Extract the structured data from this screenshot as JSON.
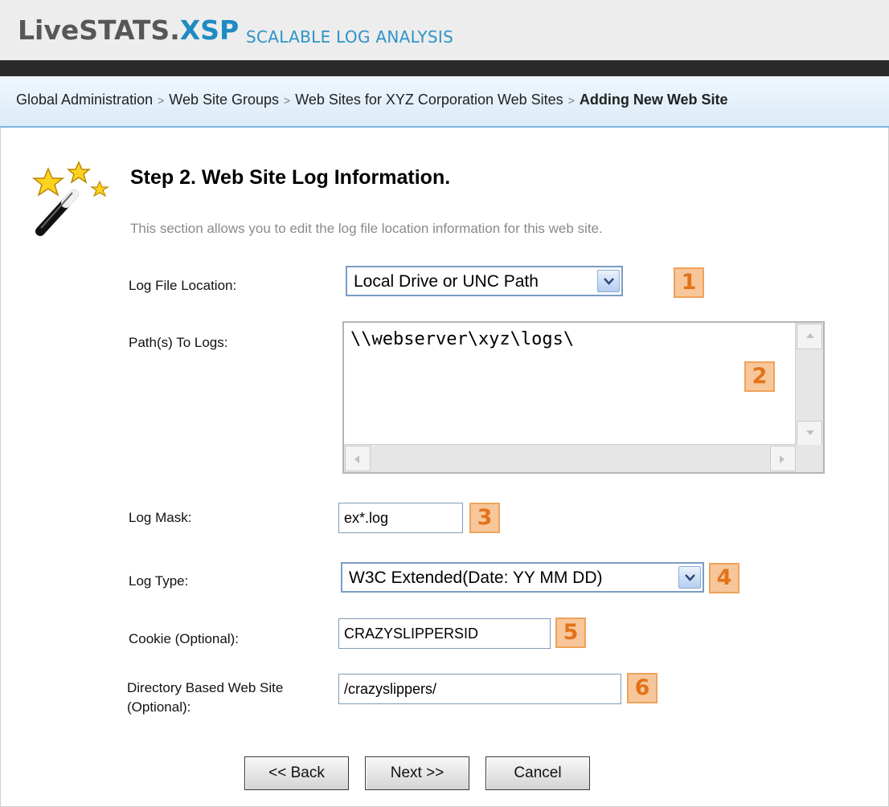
{
  "header": {
    "logo_live": "LiveSTATS.",
    "logo_xsp": "XSP",
    "tagline": "SCALABLE LOG ANALYSIS"
  },
  "breadcrumb": {
    "items": [
      "Global Administration",
      "Web Site Groups",
      "Web Sites for XYZ Corporation Web Sites"
    ],
    "separator": ">",
    "current": "Adding New Web Site"
  },
  "step": {
    "title": "Step 2. Web Site Log Information.",
    "description": "This section allows you to edit the log file location information for this web site."
  },
  "form": {
    "log_location": {
      "label": "Log File Location:",
      "value": "Local Drive or UNC Path",
      "badge": "1"
    },
    "paths": {
      "label": "Path(s) To Logs:",
      "value": "\\\\webserver\\xyz\\logs\\",
      "badge": "2"
    },
    "log_mask": {
      "label": "Log Mask:",
      "value": "ex*.log",
      "badge": "3"
    },
    "log_type": {
      "label": "Log Type:",
      "value": "W3C Extended(Date: YY MM DD)",
      "badge": "4"
    },
    "cookie": {
      "label": "Cookie (Optional):",
      "value": "CRAZYSLIPPERSID",
      "badge": "5"
    },
    "directory": {
      "label_line1": "Directory Based Web Site",
      "label_line2": "(Optional):",
      "value": "/crazyslippers/",
      "badge": "6"
    }
  },
  "buttons": {
    "back": "<< Back",
    "next": "Next >>",
    "cancel": "Cancel"
  },
  "colors": {
    "brand_blue": "#1f8bc3",
    "badge_fill": "#f7c79b",
    "badge_text": "#e2731a",
    "header_bar": "#2b2b2b"
  }
}
